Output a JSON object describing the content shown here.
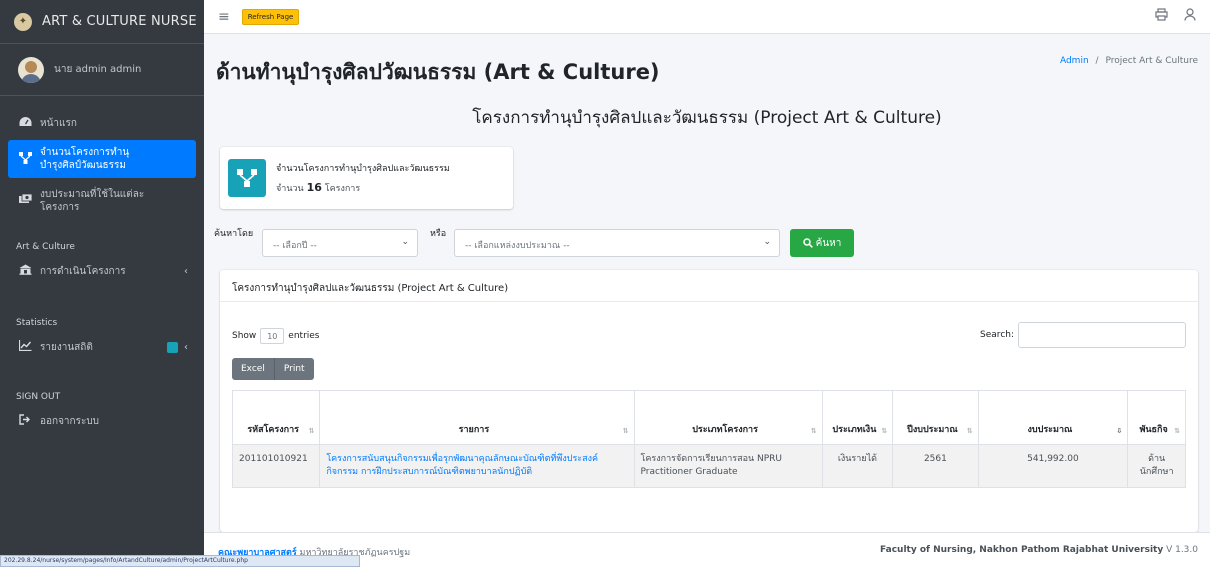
{
  "brand": {
    "title": "ART & CULTURE NURSE"
  },
  "user": {
    "name": "นาย admin admin"
  },
  "sidebar": {
    "items": [
      {
        "label": "หน้าแรก",
        "icon": "dashboard-icon"
      },
      {
        "label": "จำนวนโครงการทำนุบำรุงศิลป์วัฒนธรรม",
        "icon": "project-tree-icon",
        "active": true
      },
      {
        "label": "งบประมาณที่ใช้ในแต่ละโครงการ",
        "icon": "money-icon"
      }
    ],
    "section_art": "Art & Culture",
    "art_item": "การดำเนินโครงการ",
    "section_stats": "Statistics",
    "stats_item": "รายงานสถิติ",
    "section_signout": "SIGN OUT",
    "signout_item": "ออกจากระบบ"
  },
  "topbar": {
    "refresh_label": "Refresh Page"
  },
  "page": {
    "title": "ด้านทำนุบำรุงศิลปวัฒนธรรม (Art & Culture)",
    "breadcrumb_home": "Admin",
    "breadcrumb_sep": "/",
    "breadcrumb_current": "Project Art & Culture",
    "subtitle": "โครงการทำนุบำรุงศิลปและวัฒนธรรม (Project Art & Culture)"
  },
  "info_box": {
    "title": "จำนวนโครงการทำนุบำรุงศิลปและวัฒนธรรม",
    "count_prefix": "จำนวน",
    "count": "16",
    "count_suffix": "โครงการ"
  },
  "filter": {
    "search_by_label": "ค้นหาโดย",
    "select1_placeholder": "-- เลือกปี --",
    "or_label": "หรือ",
    "select2_placeholder": "-- เลือกแหล่งงบประมาณ --",
    "search_button": "ค้นหา"
  },
  "card": {
    "header": "โครงการทำนุบำรุงศิลปและวัฒนธรรม (Project Art & Culture)",
    "show_label": "Show",
    "show_value": "10",
    "entries_label": "entries",
    "search_label": "Search:",
    "buttons": {
      "excel": "Excel",
      "print": "Print"
    }
  },
  "table": {
    "headers": [
      "รหัสโครงการ",
      "รายการ",
      "ประเภทโครงการ",
      "ประเภทเงิน",
      "ปีงบประมาณ",
      "งบประมาณ",
      "พันธกิจ"
    ],
    "rows": [
      {
        "code": "201101010921",
        "name": "โครงการสนับสนุนกิจกรรมเพื่อรุกพัฒนาคุณลักษณะบัณฑิตที่พึงประสงค์ กิจกรรม การฝึกประสบการณ์บัณฑิตพยาบาลนักปฏิบัติ",
        "type": "โครงการจัดการเรียนการสอน NPRU Practitioner Graduate",
        "money_type": "เงินรายได้",
        "year": "2561",
        "budget": "541,992.00",
        "mission": "ด้านนักศึกษา"
      }
    ]
  },
  "footer": {
    "left_link": "คณะพยาบาลศาสตร์",
    "left_text": " มหาวิทยาลัยราชภัฏนครปฐม",
    "right_text": "Faculty of Nursing, Nakhon Pathom Rajabhat University",
    "version": "V 1.3.0"
  },
  "statusbar": {
    "url": "202.29.8.24/nurse/system/pages/Info/ArtandCulture/admin/ProjectArtCulture.php"
  },
  "colors": {
    "primary": "#007bff",
    "sidebar": "#343a40",
    "info": "#17a2b8",
    "success": "#28a745",
    "warning": "#ffc107"
  }
}
